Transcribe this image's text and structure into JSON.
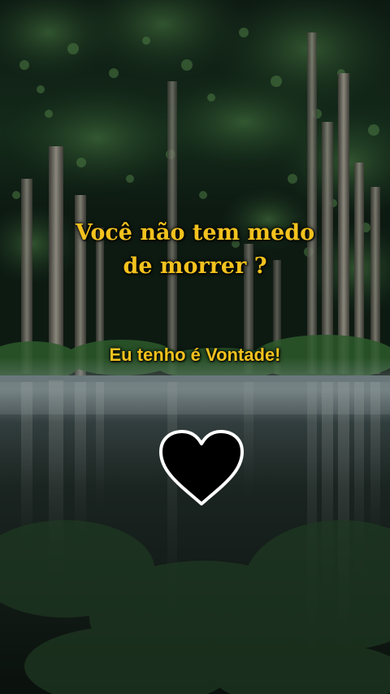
{
  "overlay": {
    "headline_line1": "Você não tem medo",
    "headline_line2": "de morrer ?",
    "subline": "Eu tenho é Vontade!"
  },
  "icons": {
    "heart": "heart-icon"
  },
  "colors": {
    "text_yellow": "#f2c21e",
    "heart_fill": "#000000",
    "heart_outline": "#ffffff"
  }
}
